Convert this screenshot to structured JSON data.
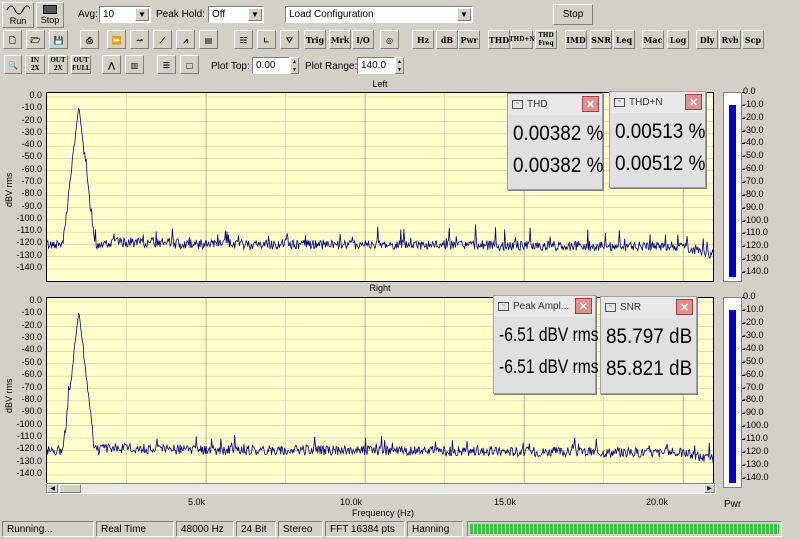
{
  "toolbar1": {
    "run_label": "Run",
    "stop_label": "Stop",
    "avg_label": "Avg:",
    "avg_value": "10",
    "peak_hold_label": "Peak Hold:",
    "peak_hold_value": "Off",
    "config_value": "Load Configuration",
    "stop_button": "Stop"
  },
  "toolbar2": {
    "buttons": [
      "Trig",
      "Mrk",
      "I/O",
      "Hz",
      "dB",
      "Pwr",
      "THD",
      "THD+N",
      "THD Freq",
      "IMD",
      "SNR",
      "Leq",
      "Mac",
      "Log",
      "Dly",
      "Rvb",
      "Scp"
    ]
  },
  "toolbar3": {
    "plot_top_label": "Plot Top:",
    "plot_top_value": "0.00",
    "plot_range_label": "Plot Range:",
    "plot_range_value": "140.0",
    "zoom_buttons": [
      "IN 2X",
      "OUT 2X",
      "OUT FULL"
    ]
  },
  "plots": {
    "left_title": "Left",
    "right_title": "Right",
    "ylabel": "dBV rms",
    "yticks": [
      "0.0",
      "-10.0",
      "-20.0",
      "-30.0",
      "-40.0",
      "-50.0",
      "-60.0",
      "-70.0",
      "-80.0",
      "-90.0",
      "-100.0",
      "-110.0",
      "-120.0",
      "-130.0",
      "-140.0"
    ],
    "xlabel": "Frequency (Hz)",
    "xticks": [
      "5.0k",
      "10.0k",
      "15.0k",
      "20.0k"
    ]
  },
  "meters": {
    "ticks": [
      "0.0",
      "-10.0",
      "-20.0",
      "-30.0",
      "-40.0",
      "-50.0",
      "-60.0",
      "-70.0",
      "-80.0",
      "-90.0",
      "-100.0",
      "-110.0",
      "-120.0",
      "-130.0",
      "-140.0"
    ],
    "pwr_label": "Pwr",
    "left_level_dbv": -6.5,
    "right_level_dbv": -6.5
  },
  "windows": {
    "thd": {
      "title": "THD",
      "v1": "0.00382 %",
      "v2": "0.00382 %"
    },
    "thdn": {
      "title": "THD+N",
      "v1": "0.00513 %",
      "v2": "0.00512 %"
    },
    "peak": {
      "title": "Peak Ampl...",
      "v1": "-6.51 dBV rms",
      "v2": "-6.51 dBV rms"
    },
    "snr": {
      "title": "SNR",
      "v1": "85.797 dB",
      "v2": "85.821 dB"
    }
  },
  "statusbar": {
    "state": "Running...",
    "mode": "Real Time",
    "rate": "48000 Hz",
    "bits": "24 Bit",
    "channels": "Stereo",
    "fft": "FFT 16384 pts",
    "window": "Hanning"
  },
  "colors": {
    "plot_bg": "#ffffcc",
    "trace": "#000080",
    "meter_bar": "#0000cc",
    "grid": "#808080"
  },
  "chart_data": [
    {
      "type": "line",
      "title": "Left",
      "xlabel": "Frequency (Hz)",
      "ylabel": "dBV rms",
      "xlim": [
        0,
        21000
      ],
      "ylim": [
        -140,
        0
      ],
      "x": [
        0,
        500,
        1000,
        1500,
        2000,
        5000,
        10000,
        15000,
        20000,
        21000
      ],
      "y": [
        -120,
        -120,
        -7,
        -120,
        -118,
        -120,
        -120,
        -121,
        -122,
        -128
      ],
      "grid": true
    },
    {
      "type": "line",
      "title": "Right",
      "xlabel": "Frequency (Hz)",
      "ylabel": "dBV rms",
      "xlim": [
        0,
        21000
      ],
      "ylim": [
        -140,
        0
      ],
      "x": [
        0,
        500,
        1000,
        1500,
        2000,
        5000,
        10000,
        15000,
        20000,
        21000
      ],
      "y": [
        -120,
        -120,
        -7,
        -120,
        -118,
        -120,
        -120,
        -121,
        -122,
        -128
      ],
      "grid": true
    }
  ]
}
